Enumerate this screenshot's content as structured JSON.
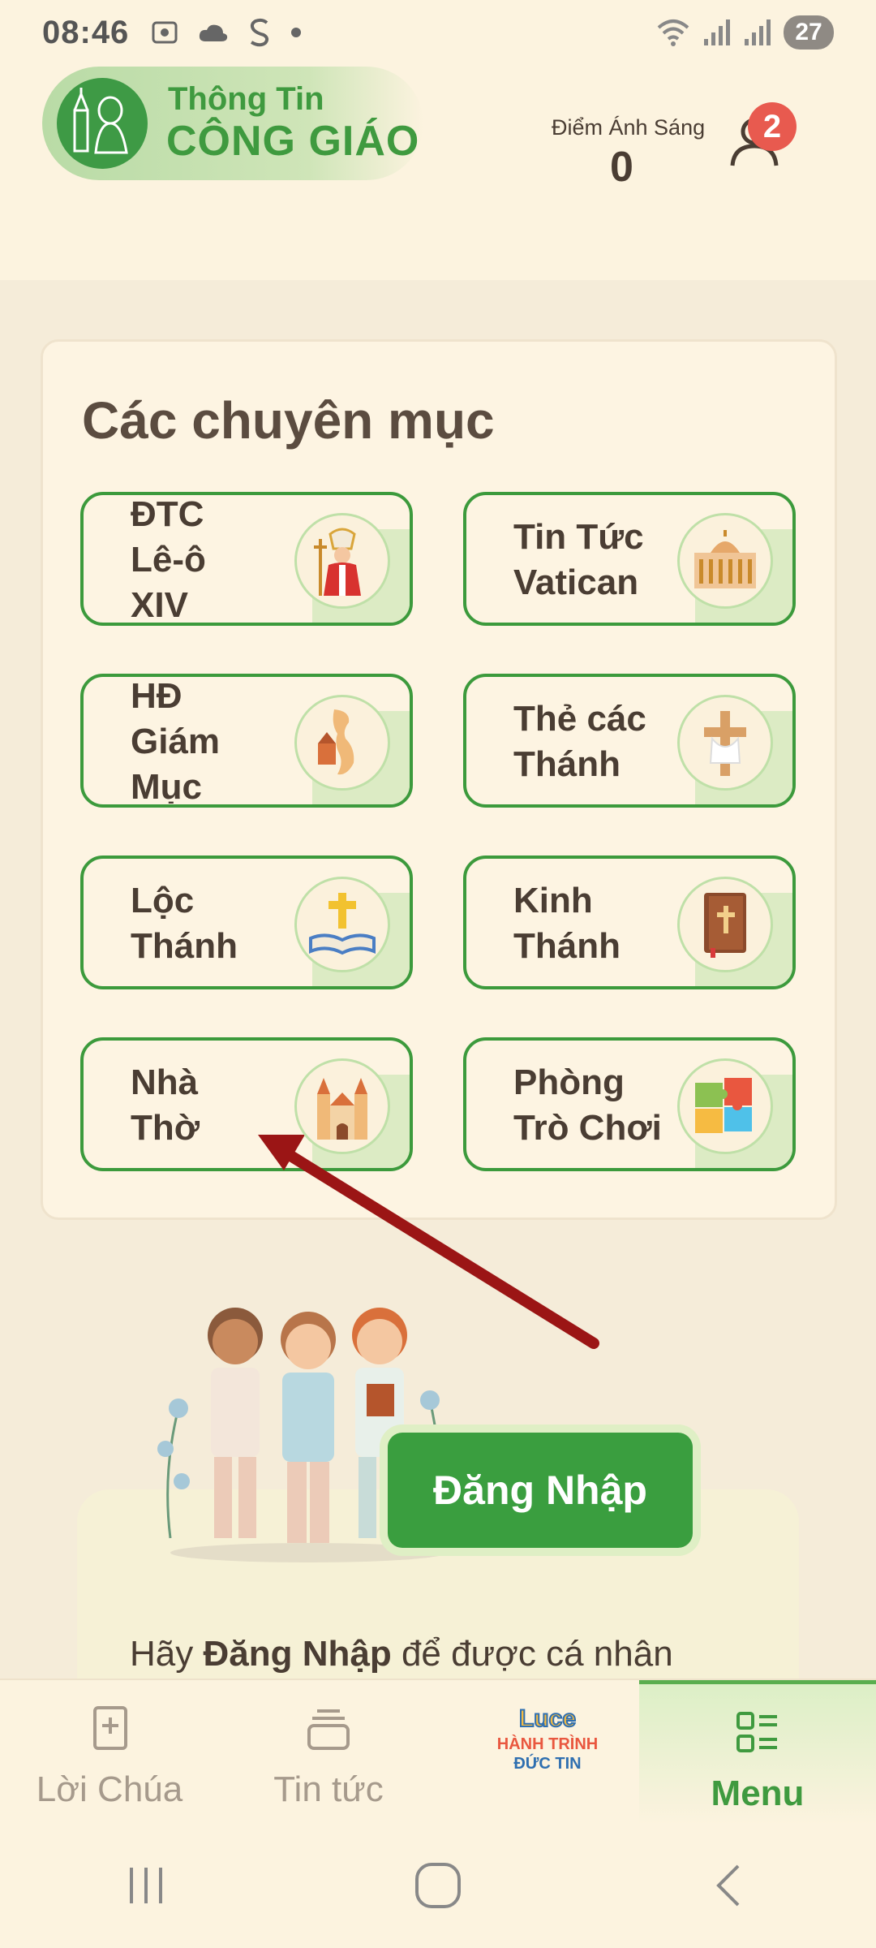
{
  "status_bar": {
    "time": "08:46",
    "battery": "27"
  },
  "header": {
    "logo_line1": "Thông Tin",
    "logo_line2": "CÔNG GIÁO",
    "points_label": "Điểm Ánh Sáng",
    "points_value": "0",
    "notification_count": "2"
  },
  "categories": {
    "title": "Các chuyên mục",
    "items": [
      {
        "label": "ĐTC\nLê-ô\nXIV",
        "icon": "pope-icon"
      },
      {
        "label": "Tin Tức\nVatican",
        "icon": "vatican-icon"
      },
      {
        "label": "HĐ\nGiám\nMục",
        "icon": "vietnam-map-icon"
      },
      {
        "label": "Thẻ các\nThánh",
        "icon": "cross-icon"
      },
      {
        "label": "Lộc\nThánh",
        "icon": "bible-cross-icon"
      },
      {
        "label": "Kinh\nThánh",
        "icon": "holy-book-icon"
      },
      {
        "label": "Nhà\nThờ",
        "icon": "church-icon"
      },
      {
        "label": "Phòng\nTrò Chơi",
        "icon": "puzzle-icon"
      }
    ]
  },
  "login": {
    "button_label": "Đăng Nhập",
    "prompt_prefix": "Hãy ",
    "prompt_bold": "Đăng Nhập",
    "prompt_suffix": " để được cá nhân"
  },
  "bottom_nav": {
    "items": [
      {
        "label": "Lời Chúa"
      },
      {
        "label": "Tin tức"
      },
      {
        "label": "Menu"
      }
    ],
    "center_logo_line1": "Luce",
    "center_logo_line2": "HÀNH TRÌNH",
    "center_logo_line3": "ĐỨC TIN"
  },
  "colors": {
    "brand_green": "#3a9e3f",
    "background": "#f5ecd9",
    "badge_red": "#e85a4f",
    "arrow_red": "#b01a1a"
  }
}
